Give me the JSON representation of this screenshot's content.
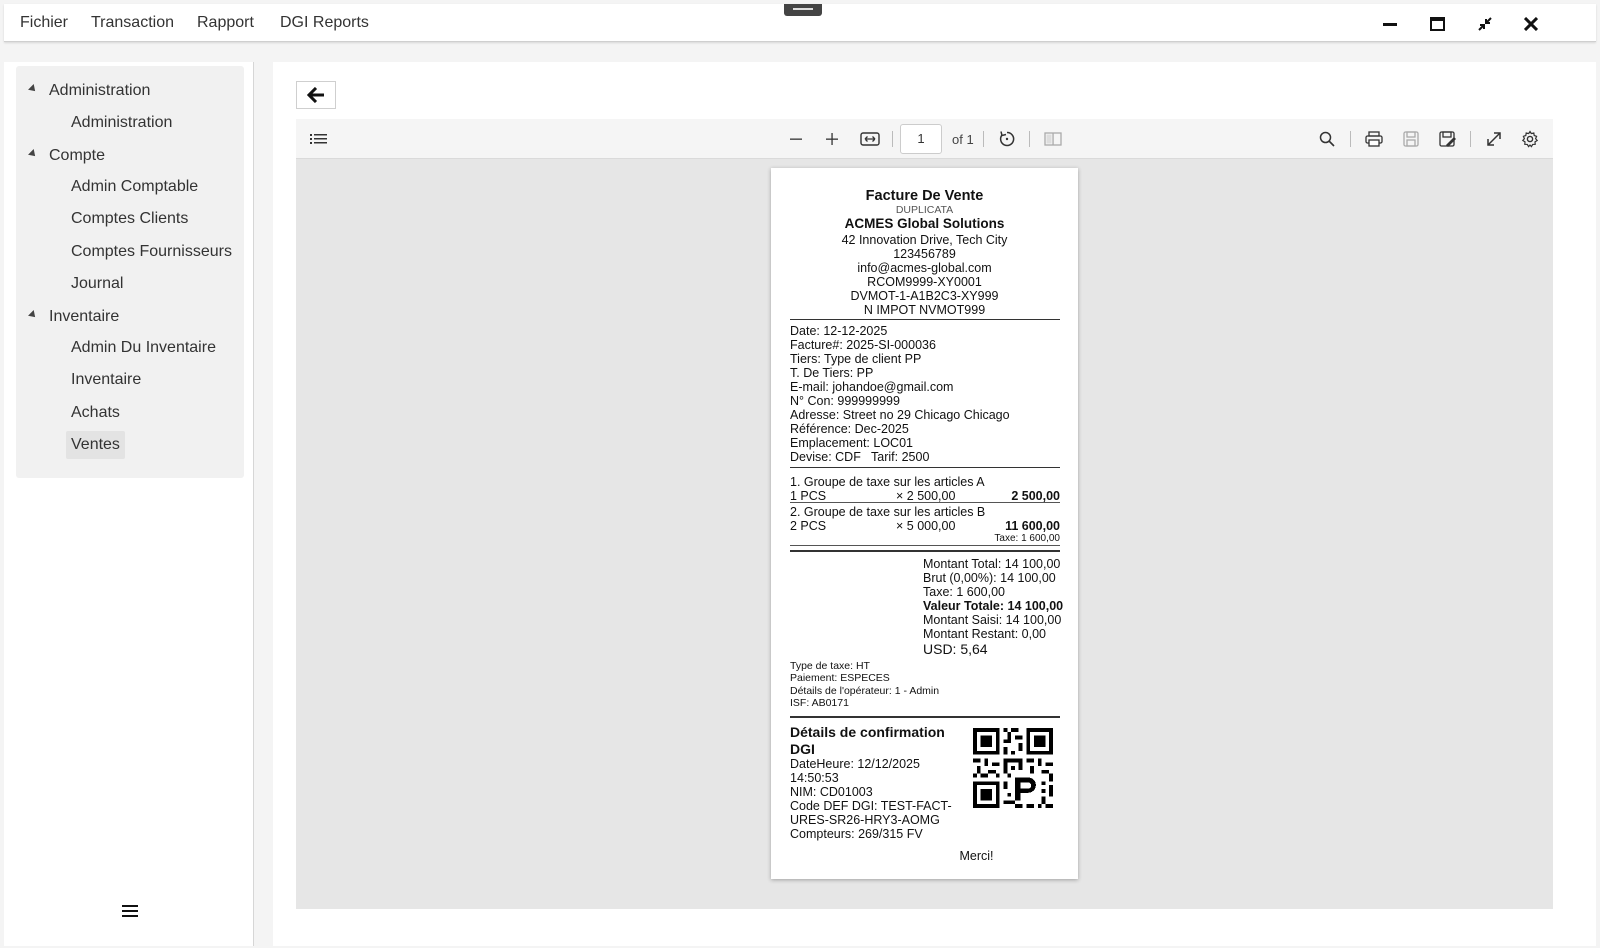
{
  "menubar": {
    "items": [
      "Fichier",
      "Transaction",
      "Rapport",
      "DGI Reports"
    ]
  },
  "sidebar": {
    "groups": [
      {
        "label": "Administration",
        "items": [
          "Administration"
        ]
      },
      {
        "label": "Compte",
        "items": [
          "Admin Comptable",
          "Comptes Clients",
          "Comptes Fournisseurs",
          "Journal"
        ]
      },
      {
        "label": "Inventaire",
        "items": [
          "Admin Du Inventaire",
          "Inventaire",
          "Achats",
          "Ventes"
        ]
      }
    ],
    "active_item": "Ventes"
  },
  "viewer": {
    "page_number": "1",
    "page_count_label": "of 1"
  },
  "receipt": {
    "title": "Facture De Vente",
    "subtitle": "DUPLICATA",
    "company": "ACMES Global Solutions",
    "header_lines": [
      "42 Innovation Drive, Tech City",
      "123456789",
      "info@acmes-global.com",
      "RCOM9999-XY0001",
      "DVMOT-1-A1B2C3-XY999",
      "N IMPOT NVMOT999"
    ],
    "info_lines": [
      "Date: 12-12-2025",
      "Facture#: 2025-SI-000036",
      "Tiers: Type de client PP",
      "T. De Tiers: PP",
      "E-mail: johandoe@gmail.com",
      "N° Con: 999999999",
      "Adresse: Street no 29 Chicago Chicago",
      "Référence: Dec-2025",
      "Emplacement: LOC01",
      "Devise: CDF   Tarif: 2500"
    ],
    "groups": [
      {
        "num": "1.",
        "name": "Groupe de taxe sur les articles A",
        "qty": "1 PCS",
        "unit": "× 2 500,00",
        "total": "2 500,00"
      },
      {
        "num": "2.",
        "name": "Groupe de taxe sur les articles B",
        "qty": "2 PCS",
        "unit": "× 5 000,00",
        "total": "11 600,00",
        "tax": "Taxe: 1 600,00"
      }
    ],
    "totals": {
      "montant_total": "Montant Total: 14 100,00",
      "brut": "Brut (0,00%): 14 100,00",
      "taxe": "Taxe: 1 600,00",
      "valeur_totale": "Valeur Totale: 14 100,00",
      "montant_saisi": "Montant Saisi: 14 100,00",
      "montant_restant": "Montant Restant: 0,00",
      "usd": "USD: 5,64"
    },
    "footer_lines": [
      "Type de taxe: HT",
      "Paiement: ESPECES",
      "Détails de l'opérateur: 1 - Admin",
      "ISF: AB0171"
    ],
    "dgi": {
      "title_1": "Détails de confirmation",
      "title_2": "DGI",
      "lines": [
        "DateHeure: 12/12/2025",
        "14:50:53",
        "NIM: CD01003",
        "Code DEF DGI: TEST-FACT-",
        "URES-SR26-HRY3-AOMG",
        "Compteurs: 269/315 FV"
      ]
    },
    "thanks": "Merci!"
  },
  "icons": {
    "minimize": "minimize-icon",
    "maximize": "maximize-icon",
    "restore": "collapse-icon",
    "close": "close-icon",
    "back": "arrow-left-icon",
    "outline": "list-icon",
    "zoom_out": "minus-icon",
    "zoom_in": "plus-icon",
    "fit": "fit-width-icon",
    "rotate": "rotate-icon",
    "spread": "page-spread-icon",
    "search": "search-icon",
    "print": "print-icon",
    "save": "save-icon",
    "save_edit": "save-edit-icon",
    "fullscreen": "expand-icon",
    "settings": "gear-icon",
    "menu": "hamburger-icon"
  },
  "colors": {
    "viewer_bg": "#e6e6e6",
    "active_item_bg": "#e3e3e3",
    "tree_bg": "#f1f1f1"
  }
}
